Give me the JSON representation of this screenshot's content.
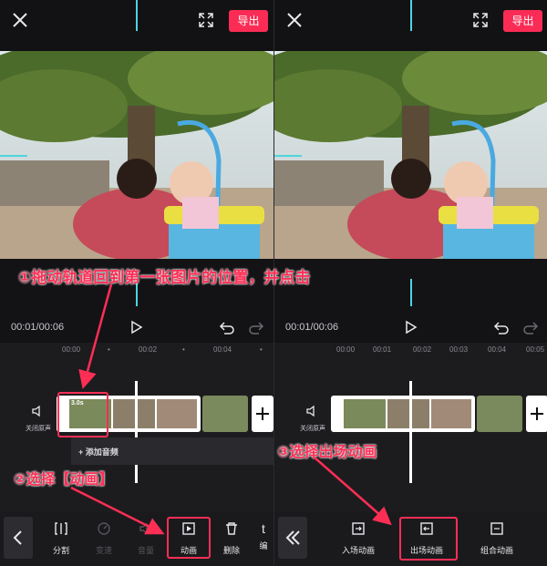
{
  "colors": {
    "accent": "#fa2c55",
    "annotation": "#ff2e55",
    "cursor": "#4fd4e0"
  },
  "left": {
    "export_label": "导出",
    "timecode": "00:01/00:06",
    "ruler": [
      "00:00",
      "00:02",
      "00:04"
    ],
    "mute_label": "关闭原声",
    "clip_duration": "3.0s",
    "add_audio_label": "添加音频",
    "tools": [
      {
        "label": "分割",
        "icon": "split-icon",
        "dim": false
      },
      {
        "label": "变速",
        "icon": "speed-icon",
        "dim": true
      },
      {
        "label": "音量",
        "icon": "volume-icon",
        "dim": true
      },
      {
        "label": "动画",
        "icon": "animation-icon",
        "dim": false
      },
      {
        "label": "删除",
        "icon": "delete-icon",
        "dim": false
      },
      {
        "label": "编",
        "icon": "edit-icon",
        "dim": false
      }
    ]
  },
  "right": {
    "export_label": "导出",
    "timecode": "00:01/00:06",
    "ruler": [
      "00:00",
      "00:01",
      "00:02",
      "00:03",
      "00:04",
      "00:05"
    ],
    "mute_label": "关闭原声",
    "tools": [
      {
        "label": "入场动画",
        "icon": "enter-animation-icon"
      },
      {
        "label": "出场动画",
        "icon": "exit-animation-icon"
      },
      {
        "label": "组合动画",
        "icon": "combo-animation-icon"
      }
    ]
  },
  "annotations": {
    "step1": "①拖动轨道回到第一张图片的位置，并点击",
    "step2": "②选择【动画】",
    "step3": "③选择出场动画"
  }
}
